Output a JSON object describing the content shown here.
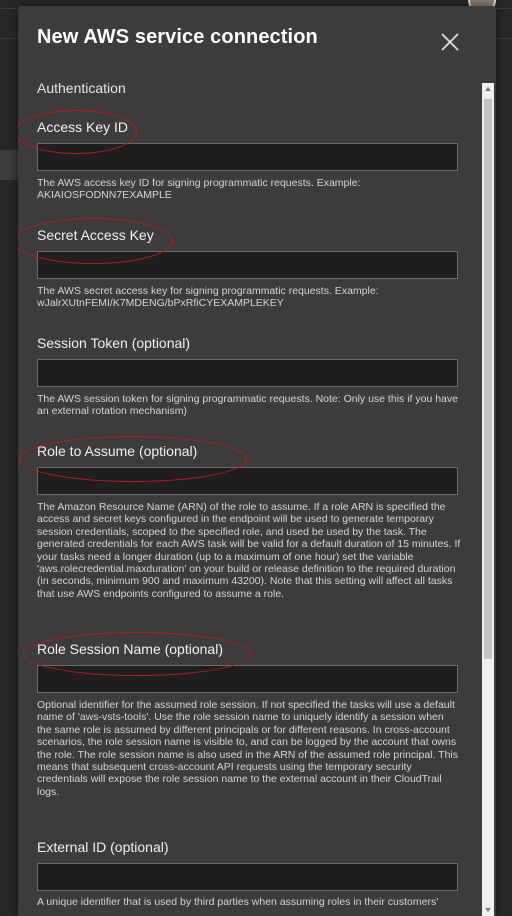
{
  "dialog": {
    "title": "New AWS service connection",
    "close_icon": "close-icon"
  },
  "section": {
    "authentication": "Authentication"
  },
  "fields": [
    {
      "label": "Access Key ID",
      "value": "",
      "help": "The AWS access key ID for signing programmatic requests. Example: AKIAIOSFODNN7EXAMPLE"
    },
    {
      "label": "Secret Access Key",
      "value": "",
      "help": "The AWS secret access key for signing programmatic requests. Example: wJalrXUtnFEMI/K7MDENG/bPxRfiCYEXAMPLEKEY"
    },
    {
      "label": "Session Token (optional)",
      "value": "",
      "help": "The AWS session token for signing programmatic requests. Note: Only use this if you have an external rotation mechanism)"
    },
    {
      "label": "Role to Assume (optional)",
      "value": "",
      "help": "The Amazon Resource Name (ARN) of the role to assume. If a role ARN is specified the access and secret keys configured in the endpoint will be used to generate temporary session credentials, scoped to the specified role, and used be used by the task. The generated credentials for each AWS task will be valid for a default duration of 15 minutes. If your tasks need a longer duration (up to a maximum of one hour) set the variable 'aws.rolecredential.maxduration' on your build or release definition to the required duration (in seconds, minimum 900 and maximum 43200). Note that this setting will affect all tasks that use AWS endpoints configured to assume a role."
    },
    {
      "label": "Role Session Name (optional)",
      "value": "",
      "help": "Optional identifier for the assumed role session. If not specified the tasks will use a default name of 'aws-vsts-tools'. Use the role session name to uniquely identify a session when the same role is assumed by different principals or for different reasons. In cross-account scenarios, the role session name is visible to, and can be logged by the account that owns the role. The role session name is also used in the ARN of the assumed role principal. This means that subsequent cross-account API requests using the temporary security credentials will expose the role session name to the external account in their CloudTrail logs."
    },
    {
      "label": "External ID (optional)",
      "value": "",
      "help": "A unique identifier that is used by third parties when assuming roles in their customers'"
    }
  ],
  "annotation_color": "#b51d1d",
  "accent_background": "#3c3c3c"
}
